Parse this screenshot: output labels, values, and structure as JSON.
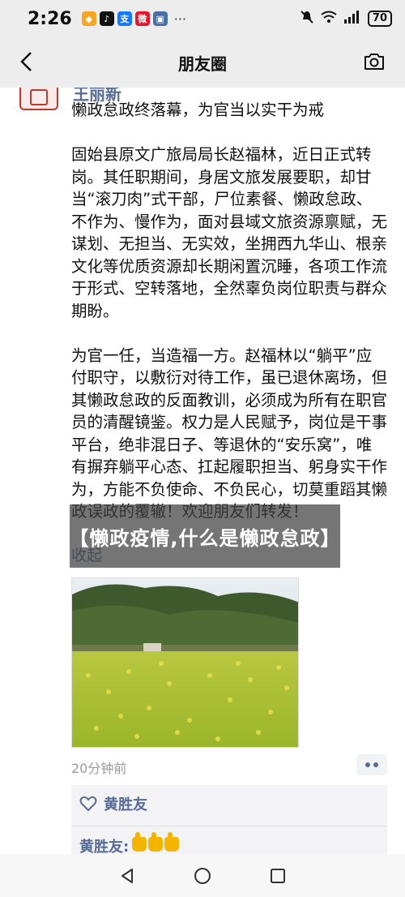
{
  "status": {
    "time": "2:26",
    "apps": [
      {
        "icon": "pin-app-icon",
        "color": "#f5a623",
        "glyph": "◆"
      },
      {
        "icon": "tiktok-icon",
        "color": "#111111",
        "glyph": "♪"
      },
      {
        "icon": "alipay-icon",
        "color": "#1677ff",
        "glyph": "支"
      },
      {
        "icon": "weibo-icon",
        "color": "#e6162d",
        "glyph": "微"
      },
      {
        "icon": "gallery-icon",
        "color": "#4a6fa5",
        "glyph": "▣"
      }
    ],
    "more": "···",
    "battery": "70"
  },
  "nav": {
    "title": "朋友圈"
  },
  "post": {
    "author": "王丽新",
    "paragraphs": [
      "懒政怠政终落幕，为官当以实干为戒",
      "固始县原文广旅局局长赵福林，近日正式转岗。其任职期间，身居文旅发展要职，却甘当“滚刀肉”式干部，尸位素餐、懒政怠政、不作为、慢作为，面对县域文旅资源禀赋，无谋划、无担当、无实效，坐拥西九华山、根亲文化等优质资源却长期闲置沉睡，各项工作流于形式、空转落地，全然辜负岗位职责与群众期盼。",
      "为官一任，当造福一方。赵福林以“躺平”应付职守，以敷衍对待工作，虽已退休离场，但其懒政怠政的反面教训，必须成为所有在职官员的清醒镜鉴。权力是人民赋予，岗位是干事平台，绝非混日子、等退休的“安乐窝”，唯有摒弃躺平心态、扛起履职担当、躬身实干作为，方能不负使命、不负民心，切莫重蹈其懒政误政的覆辙！欢迎朋友们转发！"
    ],
    "collapse": "收起",
    "timestamp": "20分钟前"
  },
  "likes": {
    "liker": "黄胜友",
    "comment_author": "黄胜友:",
    "comment_thumbs": 3
  },
  "overlay": {
    "text": "【懒政疫情,什么是懒政怠政】"
  },
  "colors": {
    "link": "#576b95",
    "bar_bg": "#ededed"
  }
}
